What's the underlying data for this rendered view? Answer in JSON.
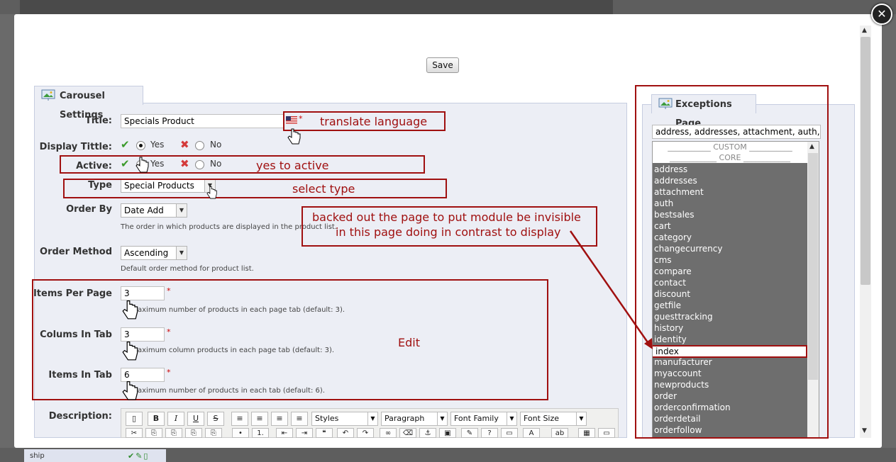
{
  "background": {
    "row_label": "ship"
  },
  "modal": {
    "close_glyph": "✕",
    "save_label": "Save"
  },
  "carousel": {
    "legend": "Carousel Settings",
    "title_label": "Title:",
    "title_value": "Specials Product",
    "display_title_label": "Display Tittle:",
    "active_label": "Active:",
    "yes_label": "Yes",
    "no_label": "No",
    "type_label": "Type",
    "type_value": "Special Products",
    "order_by_label": "Order By",
    "order_by_value": "Date Add",
    "order_by_help": "The order in which products are displayed in the product list.",
    "order_method_label": "Order Method",
    "order_method_value": "Ascending",
    "order_method_help": "Default order method for product list.",
    "items_per_page_label": "Items Per Page",
    "items_per_page_value": "3",
    "items_per_page_help": "aximum number of products in each page tab (default: 3).",
    "columns_label": "Colums In Tab",
    "columns_value": "3",
    "columns_help": "aximum column products in each page tab (default: 3).",
    "items_in_tab_label": "Items In Tab",
    "items_in_tab_value": "6",
    "items_in_tab_help": "aximum number of products in each tab (default: 6).",
    "description_label": "Description:",
    "required_mark": "*"
  },
  "editor": {
    "styles": "Styles",
    "paragraph": "Paragraph",
    "font_family": "Font Family",
    "font_size": "Font Size",
    "buttons_row1": [
      "",
      "B",
      "I",
      "U",
      "S",
      "≡",
      "≡",
      "≡",
      "≡"
    ],
    "buttons_row2": [
      "✂",
      "⎘",
      "⎘",
      "⎘",
      "⎘",
      "•",
      "1.",
      "⇤",
      "⇥",
      "❝",
      "↶",
      "↷",
      "∞",
      "⌫",
      "⚓",
      "▣",
      "✎",
      "?",
      "▭",
      "A",
      "ab",
      "▦",
      "▭"
    ]
  },
  "exceptions": {
    "legend": "Exceptions Page",
    "input_value": "address, addresses, attachment, auth, be",
    "custom_header": "___________ CUSTOM ___________",
    "core_header": "____________ CORE ____________",
    "items": [
      "address",
      "addresses",
      "attachment",
      "auth",
      "bestsales",
      "cart",
      "category",
      "changecurrency",
      "cms",
      "compare",
      "contact",
      "discount",
      "getfile",
      "guesttracking",
      "history",
      "identity",
      "index",
      "manufacturer",
      "myaccount",
      "newproducts",
      "order",
      "orderconfirmation",
      "orderdetail",
      "orderfollow"
    ],
    "selected_index": 16
  },
  "annotations": {
    "translate": "translate language",
    "active": "yes to active",
    "type": "select type",
    "exceptions_note_line1": "backed out the page to put module be invisible",
    "exceptions_note_line2": "in this page doing in contrast to display",
    "edit": "Edit"
  },
  "colors": {
    "annotation": "#a01010",
    "fieldset_bg": "#eceef5",
    "list_bg": "#6e6e6e"
  }
}
